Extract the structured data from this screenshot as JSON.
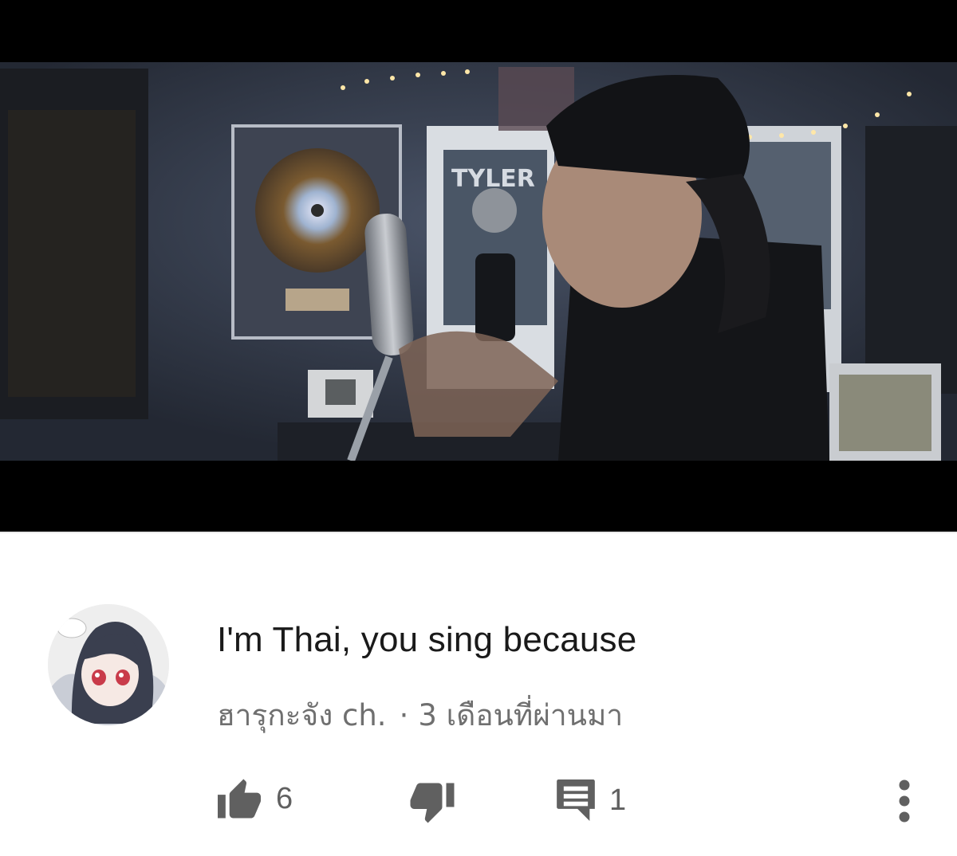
{
  "comment": {
    "text": "I'm Thai, you sing because",
    "author": "ฮารุกะจัง ch.",
    "separator": "·",
    "time": "3 เดือนที่ผ่านมา",
    "likes": "6",
    "replies": "1"
  },
  "icons": {
    "like": "thumbs-up-icon",
    "dislike": "thumbs-down-icon",
    "reply": "comment-icon",
    "more": "more-vertical-icon"
  },
  "colors": {
    "text": "#1a1a1a",
    "meta": "#6f6f6f",
    "icon": "#606060"
  }
}
